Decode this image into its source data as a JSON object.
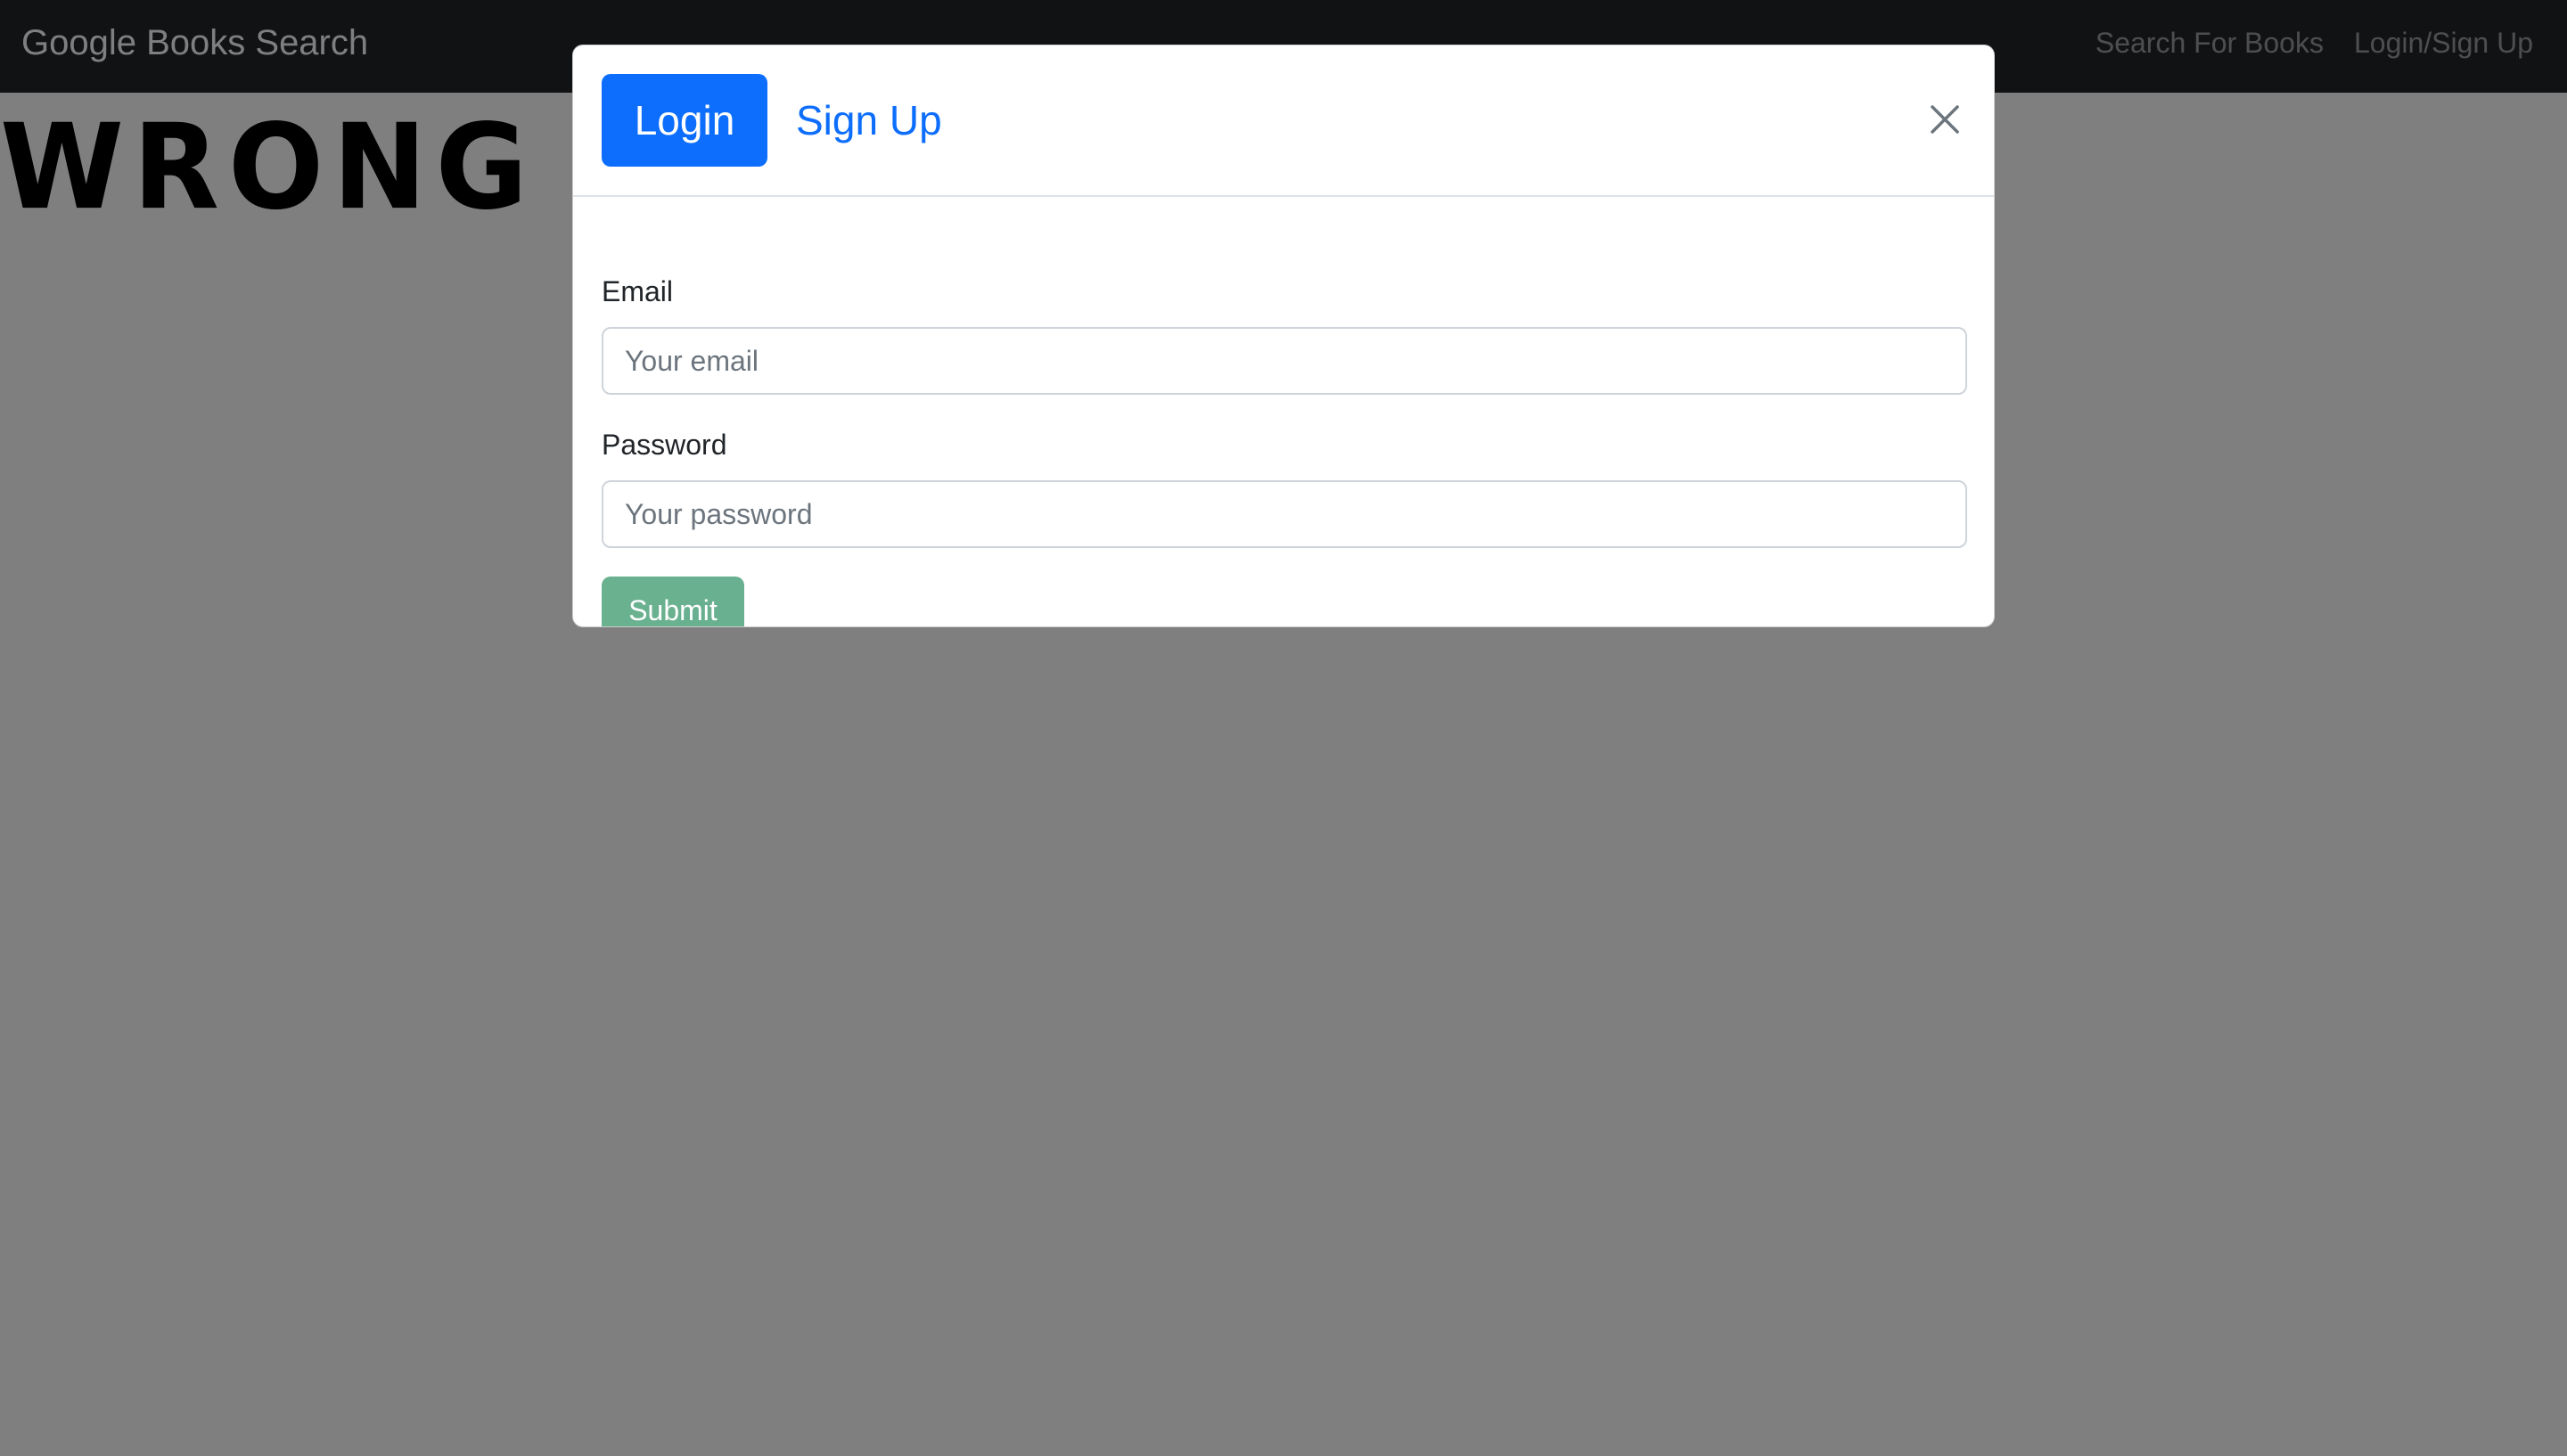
{
  "navbar": {
    "brand": "Google Books Search",
    "links": [
      "Search For Books",
      "Login/Sign Up"
    ]
  },
  "page": {
    "heading": "WRONG"
  },
  "modal": {
    "tabs": {
      "login": "Login",
      "signup": "Sign Up"
    },
    "close_icon": "close-icon",
    "form": {
      "email_label": "Email",
      "email_placeholder": "Your email",
      "email_value": "",
      "password_label": "Password",
      "password_placeholder": "Your password",
      "password_value": "",
      "submit_label": "Submit"
    }
  },
  "colors": {
    "navbar_bg": "#212529",
    "primary": "#0d6efd",
    "submit": "#198754",
    "backdrop": "rgba(0,0,0,0.5)"
  }
}
